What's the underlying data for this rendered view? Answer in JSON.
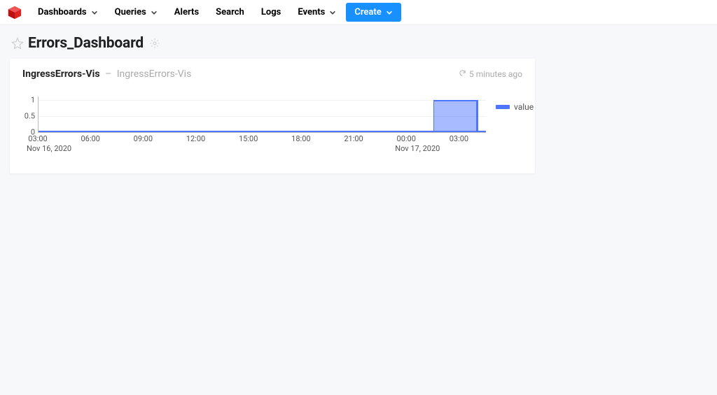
{
  "nav": {
    "items": [
      {
        "label": "Dashboards",
        "hasChevron": true
      },
      {
        "label": "Queries",
        "hasChevron": true
      },
      {
        "label": "Alerts",
        "hasChevron": false
      },
      {
        "label": "Search",
        "hasChevron": false
      },
      {
        "label": "Logs",
        "hasChevron": false
      },
      {
        "label": "Events",
        "hasChevron": true
      }
    ],
    "create_label": "Create"
  },
  "dashboard": {
    "title": "Errors_Dashboard"
  },
  "card": {
    "title": "IngressErrors-Vis",
    "separator": " – ",
    "subtitle": "IngressErrors-Vis",
    "updated": "5 minutes ago"
  },
  "legend": {
    "series_name": "value"
  },
  "chart_data": {
    "type": "area",
    "series": [
      {
        "name": "value",
        "x_hours_from_start": [
          0,
          22.5,
          22.5,
          25,
          25,
          25.5
        ],
        "values": [
          0,
          0,
          1,
          1,
          0,
          0
        ]
      }
    ],
    "x_ticks": [
      "03:00",
      "06:00",
      "09:00",
      "12:00",
      "15:00",
      "18:00",
      "21:00",
      "00:00",
      "03:00"
    ],
    "x_tick_hours_from_start": [
      0,
      3,
      6,
      9,
      12,
      15,
      18,
      21,
      24
    ],
    "x_range_hours": [
      0,
      25.5
    ],
    "x_date_labels": [
      {
        "label": "Nov 16, 2020",
        "at_hour": 0,
        "align": "left"
      },
      {
        "label": "Nov 17, 2020",
        "at_hour": 21,
        "align": "left"
      }
    ],
    "y_ticks": [
      0,
      0.5,
      1
    ],
    "ylim": [
      0,
      1.1
    ],
    "title": "",
    "xlabel": "",
    "ylabel": ""
  }
}
